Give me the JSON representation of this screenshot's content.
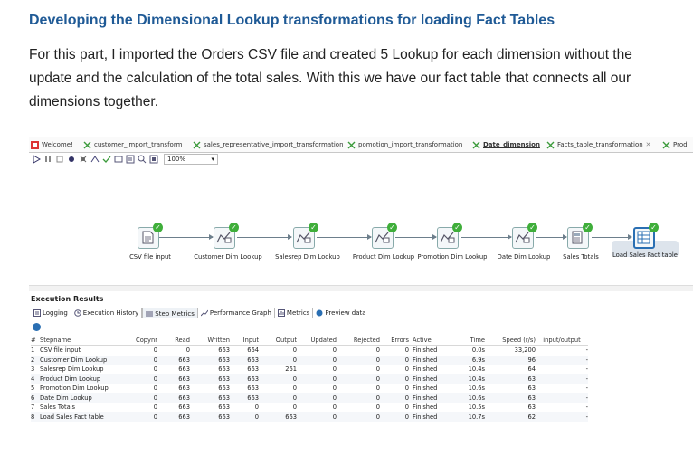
{
  "article": {
    "title": "Developing the Dimensional Lookup transformations for loading Fact Tables",
    "body": "For this part, I imported the Orders CSV file and created 5 Lookup for each dimension without the update and the calculation of the total sales. With this we have our fact table that connects all our dimensions together."
  },
  "tabs": [
    {
      "label": "Welcome!",
      "icon": "welcome-icon"
    },
    {
      "label": "customer_import_transform",
      "icon": "transformation-icon"
    },
    {
      "label": "sales_representative_import_transformation",
      "icon": "transformation-icon"
    },
    {
      "label": "pomotion_import_transformation",
      "icon": "transformation-icon"
    },
    {
      "label": "Date_dimension",
      "icon": "transformation-icon"
    },
    {
      "label": "Facts_table_transformation",
      "icon": "transformation-icon"
    },
    {
      "label": "Prod",
      "icon": "transformation-icon"
    }
  ],
  "toolbar": {
    "zoom": "100%"
  },
  "steps": [
    {
      "label": "CSV file input",
      "icon": "csv-file-icon"
    },
    {
      "label": "Customer Dim Lookup",
      "icon": "lookup-icon"
    },
    {
      "label": "Salesrep Dim Lookup",
      "icon": "lookup-icon"
    },
    {
      "label": "Product Dim Lookup",
      "icon": "lookup-icon"
    },
    {
      "label": "Promotion Dim Lookup",
      "icon": "lookup-icon"
    },
    {
      "label": "Date Dim Lookup",
      "icon": "lookup-icon"
    },
    {
      "label": "Sales Totals",
      "icon": "calculator-icon"
    },
    {
      "label": "Load Sales Fact table",
      "icon": "table-output-icon"
    }
  ],
  "results": {
    "title": "Execution Results",
    "tabs": [
      "Logging",
      "Execution History",
      "Step Metrics",
      "Performance Graph",
      "Metrics",
      "Preview data"
    ],
    "columns": [
      "#",
      "Stepname",
      "Copynr",
      "Read",
      "Written",
      "Input",
      "Output",
      "Updated",
      "Rejected",
      "Errors",
      "Active",
      "Time",
      "Speed (r/s)",
      "input/output"
    ],
    "rows": [
      [
        "1",
        "CSV file input",
        "0",
        "0",
        "663",
        "664",
        "0",
        "0",
        "0",
        "0",
        "Finished",
        "0.0s",
        "33,200",
        "-"
      ],
      [
        "2",
        "Customer Dim Lookup",
        "0",
        "663",
        "663",
        "663",
        "0",
        "0",
        "0",
        "0",
        "Finished",
        "6.9s",
        "96",
        "-"
      ],
      [
        "3",
        "Salesrep Dim Lookup",
        "0",
        "663",
        "663",
        "663",
        "261",
        "0",
        "0",
        "0",
        "Finished",
        "10.4s",
        "64",
        "-"
      ],
      [
        "4",
        "Product Dim Lookup",
        "0",
        "663",
        "663",
        "663",
        "0",
        "0",
        "0",
        "0",
        "Finished",
        "10.4s",
        "63",
        "-"
      ],
      [
        "5",
        "Promotion Dim Lookup",
        "0",
        "663",
        "663",
        "663",
        "0",
        "0",
        "0",
        "0",
        "Finished",
        "10.6s",
        "63",
        "-"
      ],
      [
        "6",
        "Date Dim Lookup",
        "0",
        "663",
        "663",
        "663",
        "0",
        "0",
        "0",
        "0",
        "Finished",
        "10.6s",
        "63",
        "-"
      ],
      [
        "7",
        "Sales Totals",
        "0",
        "663",
        "663",
        "0",
        "0",
        "0",
        "0",
        "0",
        "Finished",
        "10.5s",
        "63",
        "-"
      ],
      [
        "8",
        "Load Sales Fact table",
        "0",
        "663",
        "663",
        "0",
        "663",
        "0",
        "0",
        "0",
        "Finished",
        "10.7s",
        "62",
        "-"
      ]
    ]
  },
  "colors": {
    "title": "#1f5a96",
    "check": "#3fae3a",
    "hop": "#6d7f8c"
  }
}
